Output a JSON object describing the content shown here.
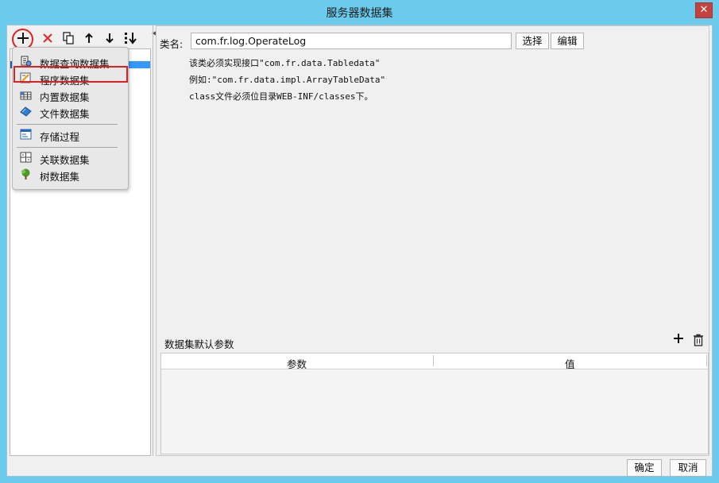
{
  "window": {
    "title": "服务器数据集",
    "close": "✕"
  },
  "menu": {
    "items": [
      {
        "label": "数据查询数据集",
        "icon": "db-query-icon"
      },
      {
        "label": "程序数据集",
        "icon": "program-dataset-icon"
      },
      {
        "label": "内置数据集",
        "icon": "builtin-dataset-icon"
      },
      {
        "label": "文件数据集",
        "icon": "file-dataset-icon"
      },
      {
        "label": "存储过程",
        "icon": "stored-procedure-icon"
      },
      {
        "label": "关联数据集",
        "icon": "relation-dataset-icon"
      },
      {
        "label": "树数据集",
        "icon": "tree-dataset-icon"
      }
    ]
  },
  "detail": {
    "class_label": "类名:",
    "class_value": "com.fr.log.OperateLog",
    "select_button": "选择",
    "edit_button": "编辑",
    "description": [
      "该类必须实现接口\"com.fr.data.Tabledata\"",
      "例如:\"com.fr.data.impl.ArrayTableData\"",
      "class文件必须位目录WEB-INF/classes下。"
    ]
  },
  "params": {
    "title": "数据集默认参数",
    "columns": [
      "参数",
      "值"
    ]
  },
  "footer": {
    "ok": "确定",
    "cancel": "取消"
  },
  "colors": {
    "title_bar": "#6bcbec",
    "close": "#c4413d",
    "highlight": "#e02020",
    "selection": "#3399ff"
  }
}
